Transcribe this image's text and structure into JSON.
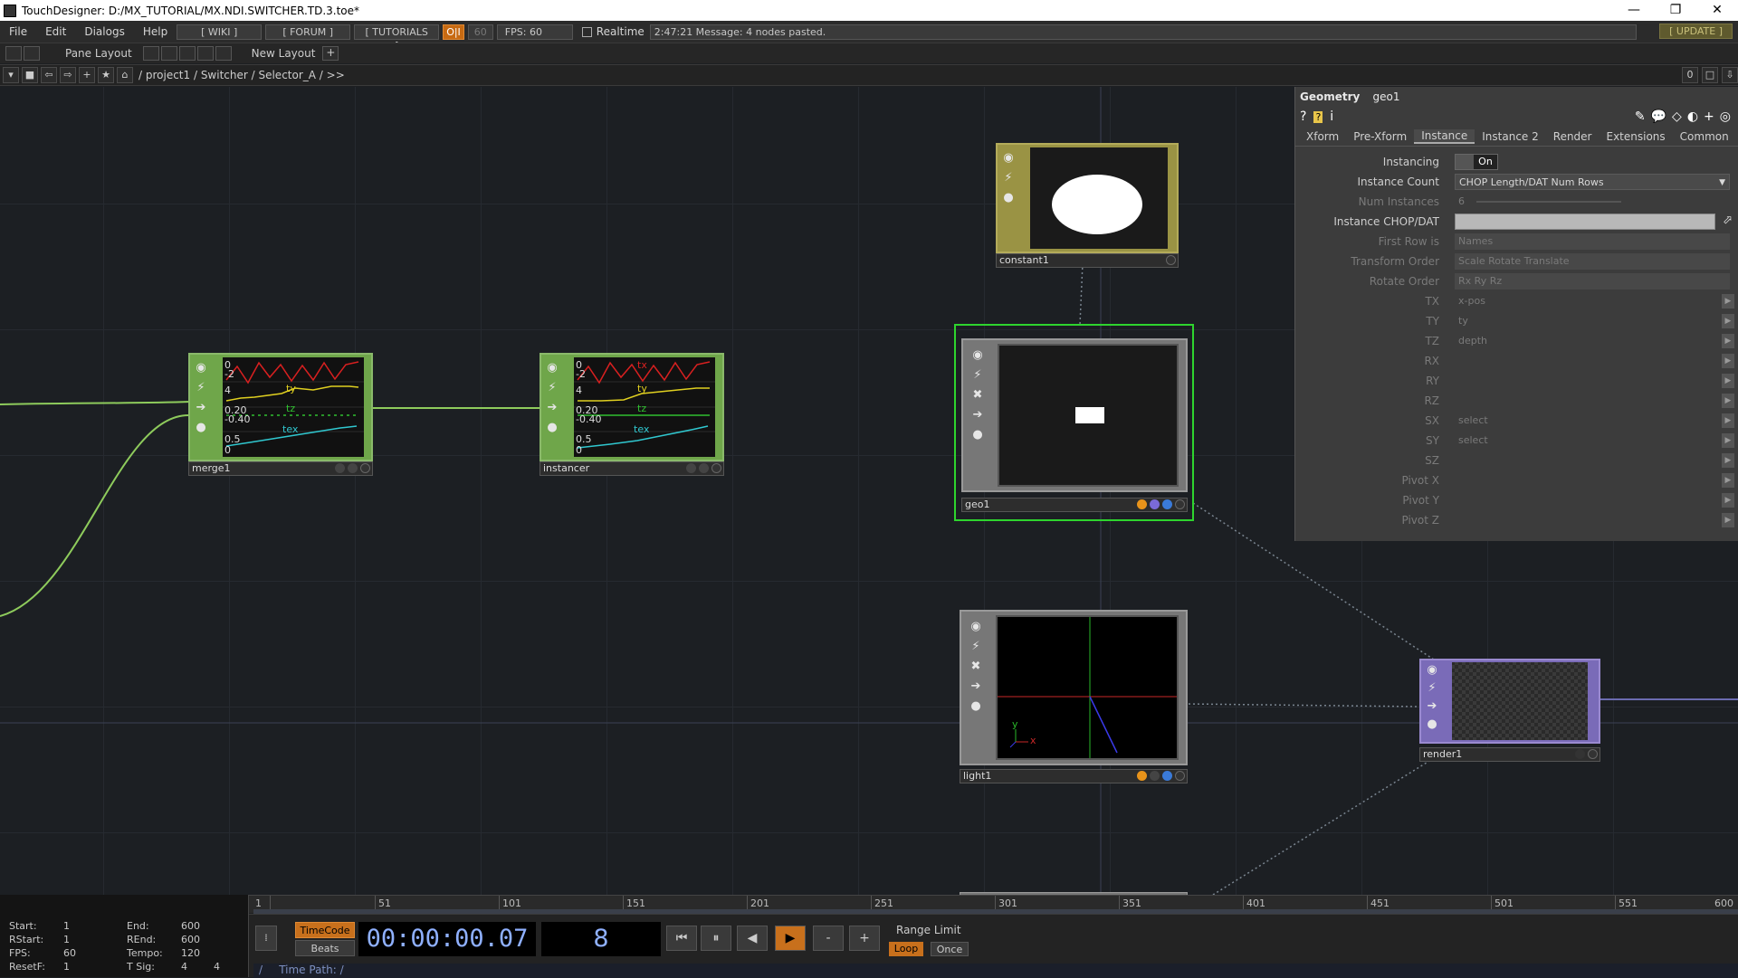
{
  "window": {
    "title": "TouchDesigner: D:/MX_TUTORIAL/MX.NDI.SWITCHER.TD.3.toe*",
    "controls": [
      "—",
      "❐",
      "✕"
    ]
  },
  "menubar": {
    "menus": [
      "File",
      "Edit",
      "Dialogs",
      "Help"
    ],
    "wiki": "[ WIKI ]",
    "forum": "[ FORUM ]",
    "tutorials": "[ TUTORIALS ]",
    "oi": "O|I",
    "fps_target": "60",
    "fps": "FPS:  60",
    "realtime": "Realtime",
    "message": "2:47:21 Message: 4 nodes pasted.",
    "update": "[ UPDATE ]"
  },
  "layoutbar": {
    "pane_layout": "Pane Layout",
    "new_layout": "New Layout",
    "add": "+"
  },
  "pathbar": {
    "path": "/ project1 / Switcher / Selector_A / >>",
    "right_value": "0"
  },
  "nodes": {
    "merge1": {
      "name": "merge1",
      "channels": [
        "ty",
        "tz",
        "tex"
      ],
      "values": [
        "0",
        "-2",
        "4",
        "0.20",
        "-0.40",
        "0.5",
        "0"
      ]
    },
    "instancer": {
      "name": "instancer",
      "channels": [
        "tx",
        "ty",
        "tz",
        "tex"
      ],
      "values": [
        "0",
        "-2",
        "4",
        "0.20",
        "-0.40",
        "0.5",
        "0"
      ]
    },
    "constant1": {
      "name": "constant1"
    },
    "geo1": {
      "name": "geo1"
    },
    "light1": {
      "name": "light1",
      "axis_x": "x",
      "axis_y": "y"
    },
    "render1": {
      "name": "render1"
    }
  },
  "params": {
    "title": "Geometry",
    "op_name": "geo1",
    "tabs": [
      "Xform",
      "Pre-Xform",
      "Instance",
      "Instance 2",
      "Render",
      "Extensions",
      "Common"
    ],
    "active_tab": "Instance",
    "rows": [
      {
        "label": "Instancing",
        "value": "On"
      },
      {
        "label": "Instance Count",
        "value": "CHOP Length/DAT Num Rows"
      },
      {
        "label": "Num Instances",
        "value": "6"
      },
      {
        "label": "Instance CHOP/DAT",
        "value": ""
      },
      {
        "label": "First Row is",
        "value": "Names"
      },
      {
        "label": "Transform Order",
        "value": "Scale Rotate Translate"
      },
      {
        "label": "Rotate Order",
        "value": "Rx Ry Rz"
      },
      {
        "label": "TX",
        "value": "x-pos"
      },
      {
        "label": "TY",
        "value": "ty"
      },
      {
        "label": "TZ",
        "value": "depth"
      },
      {
        "label": "RX",
        "value": ""
      },
      {
        "label": "RY",
        "value": ""
      },
      {
        "label": "RZ",
        "value": ""
      },
      {
        "label": "SX",
        "value": "select"
      },
      {
        "label": "SY",
        "value": "select"
      },
      {
        "label": "SZ",
        "value": ""
      },
      {
        "label": "Pivot X",
        "value": ""
      },
      {
        "label": "Pivot Y",
        "value": ""
      },
      {
        "label": "Pivot Z",
        "value": ""
      }
    ]
  },
  "timeline": {
    "ticks": [
      "1",
      "51",
      "101",
      "151",
      "201",
      "251",
      "301",
      "351",
      "401",
      "451",
      "501",
      "551",
      "600"
    ]
  },
  "stats": {
    "start_label": "Start:",
    "start": "1",
    "end_label": "End:",
    "end": "600",
    "rstart_label": "RStart:",
    "rstart": "1",
    "rend_label": "REnd:",
    "rend": "600",
    "fps_label": "FPS:",
    "fps": "60",
    "tempo_label": "Tempo:",
    "tempo": "120",
    "resetf_label": "ResetF:",
    "resetf": "1",
    "tsig_label": "T Sig:",
    "tsig_a": "4",
    "tsig_b": "4"
  },
  "transport": {
    "timecode": "TimeCode",
    "beats": "Beats",
    "time": "00:00:00.07",
    "frame": "8",
    "range_limit": "Range Limit",
    "loop": "Loop",
    "once": "Once",
    "minus": "-",
    "plus": "+",
    "time_path_label": "Time Path: /"
  }
}
